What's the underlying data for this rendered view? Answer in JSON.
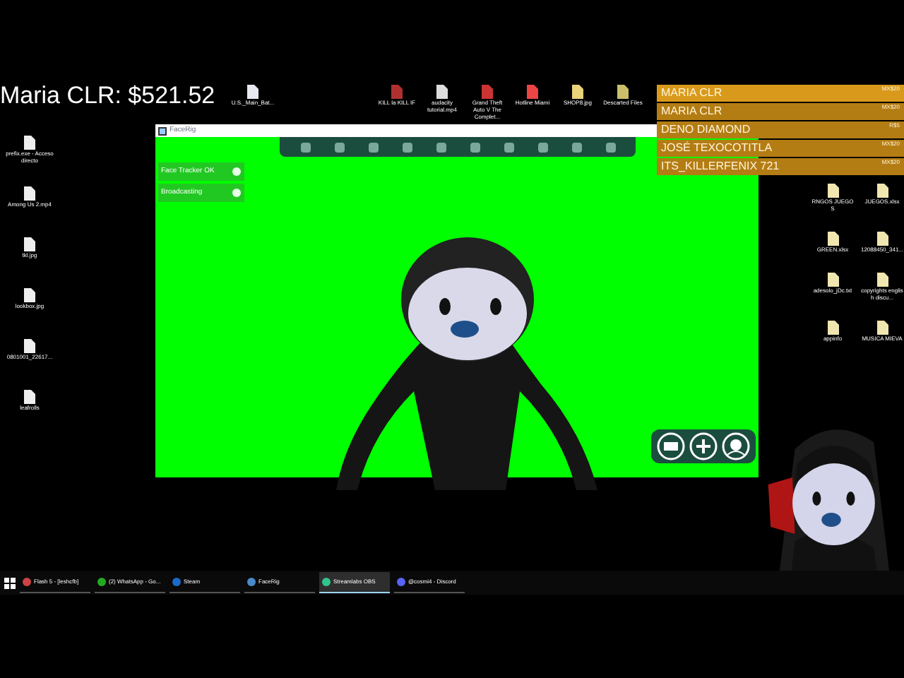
{
  "stream_overlay": {
    "balance_text": "Maria CLR: $521.52"
  },
  "donations": [
    {
      "name": "MARIA CLR",
      "amount": "MX$20"
    },
    {
      "name": "MARIA CLR",
      "amount": "MX$20"
    },
    {
      "name": "DENO DIAMOND",
      "amount": "R$5"
    },
    {
      "name": "JOSÉ TEXOCOTITLA",
      "amount": "MX$20"
    },
    {
      "name": "ITS_KILLERFENIX 721",
      "amount": "MX$20"
    }
  ],
  "desktop": {
    "top_row_icons": [
      {
        "label": "U.S._Main_Bat..."
      },
      {
        "label": "KILL la KILL IF"
      },
      {
        "label": "audacity tutorial.mp4"
      },
      {
        "label": "Grand Theft Auto V The Complet..."
      },
      {
        "label": "Hotline Miami"
      },
      {
        "label": "SHOP8.jpg"
      },
      {
        "label": "Descarted Files"
      }
    ],
    "left_column_icons": [
      {
        "label": "prefix.exe - Acceso directo"
      },
      {
        "label": "Among Us 2.mp4"
      },
      {
        "label": "tkl.jpg"
      },
      {
        "label": "lookbox.jpg"
      },
      {
        "label": "0801001_22617..."
      },
      {
        "label": "leafrolls"
      }
    ],
    "right_column_icons": [
      {
        "label": "RNGOS JUEGOS"
      },
      {
        "label": "JUEGOS.xlsx"
      },
      {
        "label": "GREEN.xlsx"
      },
      {
        "label": "12088450_341..."
      },
      {
        "label": "adesolo_jDc.txt"
      },
      {
        "label": "copyrights english discu..."
      },
      {
        "label": "appinfo"
      },
      {
        "label": "MUSICA MIEVA"
      }
    ]
  },
  "facerig": {
    "title": "FaceRig",
    "status_items": [
      {
        "label": "Face Tracker OK"
      },
      {
        "label": "Broadcasting"
      }
    ]
  },
  "taskbar": {
    "items": [
      {
        "label": "Flash 5 - [leshcfb]",
        "selected": false
      },
      {
        "label": "(2) WhatsApp - Go...",
        "selected": false
      },
      {
        "label": "Steam",
        "selected": false
      },
      {
        "label": "FaceRig",
        "selected": false
      },
      {
        "label": "Streamlabs OBS",
        "selected": true
      },
      {
        "label": "@cosmi4 - Discord",
        "selected": false
      }
    ]
  }
}
